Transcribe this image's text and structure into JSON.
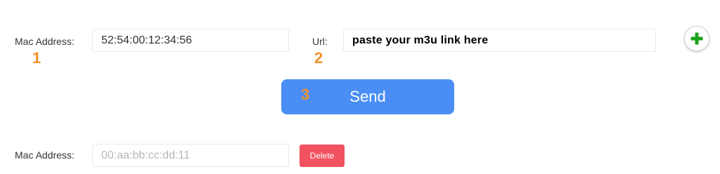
{
  "form": {
    "mac_label": "Mac Address:",
    "mac_value": "52:54:00:12:34:56",
    "url_label": "Url:",
    "url_value": "paste your m3u link here",
    "send_label": "Send"
  },
  "steps": {
    "mac": "1",
    "url": "2",
    "send": "3"
  },
  "entry": {
    "mac_label": "Mac Address:",
    "mac_placeholder": "00:aa:bb:cc:dd:11",
    "delete_label": "Delete"
  },
  "colors": {
    "send_button": "#4a8ef5",
    "delete_button": "#f0525f",
    "step_number": "#f2922a",
    "add_icon": "#1aa31a"
  },
  "icons": {
    "add": "plus-icon"
  }
}
